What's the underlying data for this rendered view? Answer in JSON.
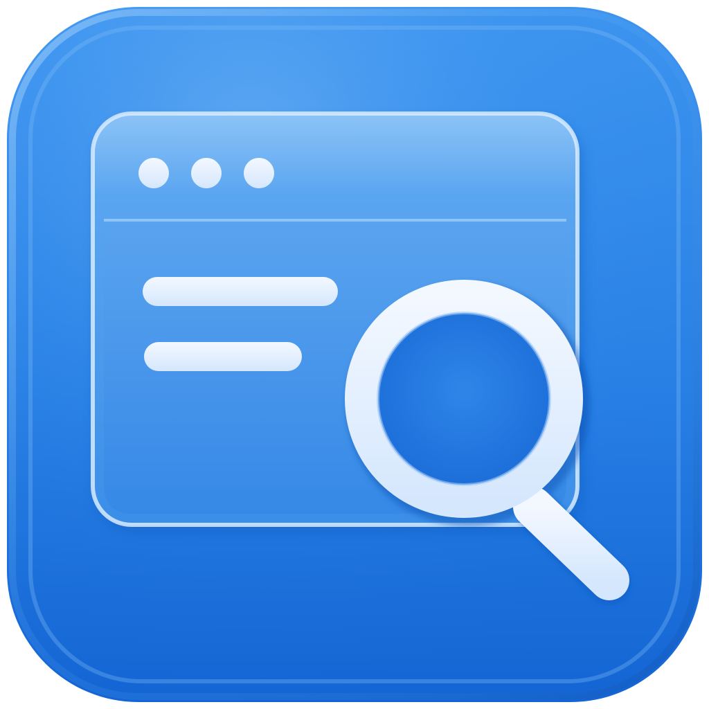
{
  "icon": {
    "name": "web-search-app-icon",
    "depicts": [
      "browser-window-icon",
      "window-dots",
      "text-lines",
      "magnifying-glass-icon"
    ]
  },
  "colors": {
    "tile_light": "#4ea0f2",
    "tile_mid": "#2a82e6",
    "tile_dark": "#0f5fc9",
    "window_fill": "#6fb2f4",
    "window_body": "#3f93ea",
    "glyph_white": "#e8f2ff",
    "glyph_shadow": "#9cc6f5"
  }
}
